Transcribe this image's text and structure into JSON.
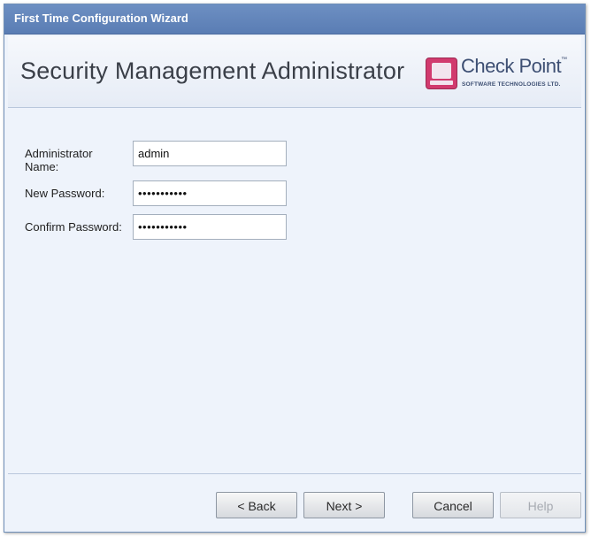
{
  "window": {
    "title": "First Time Configuration Wizard"
  },
  "header": {
    "heading": "Security Management Administrator",
    "logo": {
      "brand": "Check Point",
      "tm": "™",
      "subtitle": "SOFTWARE TECHNOLOGIES LTD.",
      "icon": "check-point-logo-icon"
    }
  },
  "form": {
    "admin_name_label": "Administrator Name:",
    "admin_name_value": "admin",
    "new_password_label": "New Password:",
    "new_password_value": "•••••••••••",
    "confirm_password_label": "Confirm Password:",
    "confirm_password_value": "•••••••••••"
  },
  "buttons": {
    "back": "< Back",
    "next": "Next >",
    "cancel": "Cancel",
    "help": "Help"
  },
  "colors": {
    "titlebar": "#5f82b9",
    "window_bg": "#eef3fb",
    "logo_accent": "#d13a6e"
  }
}
